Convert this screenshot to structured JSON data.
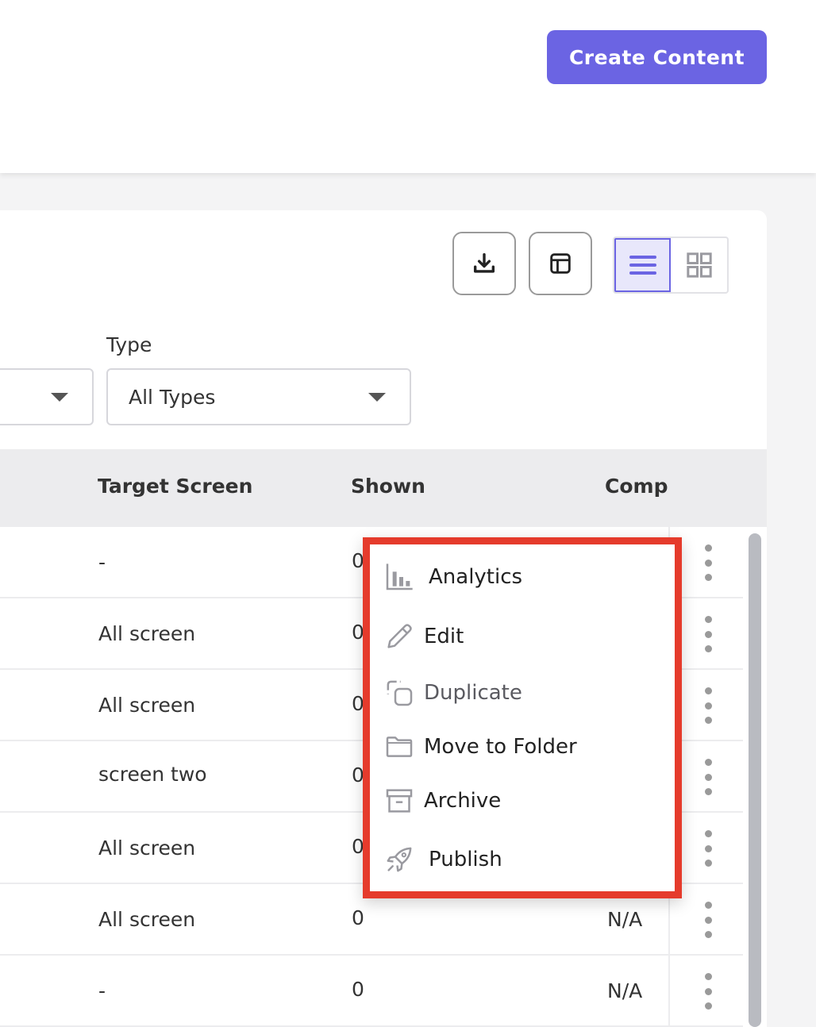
{
  "header": {
    "create_button_label": "Create Content"
  },
  "toolbar": {
    "download_icon": "download-icon",
    "columns_icon": "table-columns-icon",
    "view_list_icon": "list-view-icon",
    "view_grid_icon": "grid-view-icon",
    "active_view": "list"
  },
  "filters": {
    "type_label": "Type",
    "type_value": "All Types"
  },
  "table": {
    "columns": [
      "Target Screen",
      "Shown",
      "Comp"
    ],
    "rows": [
      {
        "target": "-",
        "shown": "0",
        "comp": ""
      },
      {
        "target": "All screen",
        "shown": "0",
        "comp": ""
      },
      {
        "target": "All screen",
        "shown": "0",
        "comp": ""
      },
      {
        "target": "screen two",
        "shown": "0",
        "comp": ""
      },
      {
        "target": "All screen",
        "shown": "0",
        "comp": ""
      },
      {
        "target": "All screen",
        "shown": "0",
        "comp": "N/A"
      },
      {
        "target": "-",
        "shown": "0",
        "comp": "N/A"
      }
    ]
  },
  "menu": {
    "items": [
      {
        "label": "Analytics",
        "icon": "analytics-icon"
      },
      {
        "label": "Edit",
        "icon": "pencil-icon"
      },
      {
        "label": "Duplicate",
        "icon": "duplicate-icon"
      },
      {
        "label": "Move to Folder",
        "icon": "folder-icon"
      },
      {
        "label": "Archive",
        "icon": "archive-icon"
      },
      {
        "label": "Publish",
        "icon": "rocket-icon"
      }
    ]
  },
  "colors": {
    "accent": "#6b64e3",
    "highlight_border": "#e53b2c",
    "header_bg": "#ececee"
  }
}
